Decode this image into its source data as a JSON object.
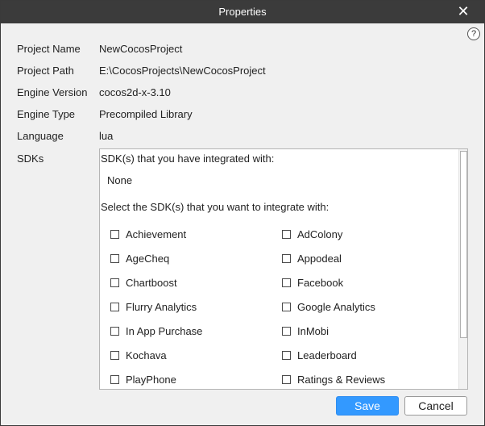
{
  "window": {
    "title": "Properties",
    "close_glyph": "✕",
    "help_glyph": "?"
  },
  "fields": [
    {
      "label": "Project Name",
      "value": "NewCocosProject"
    },
    {
      "label": "Project Path",
      "value": "E:\\CocosProjects\\NewCocosProject"
    },
    {
      "label": "Engine Version",
      "value": "cocos2d-x-3.10"
    },
    {
      "label": "Engine Type",
      "value": "Precompiled Library"
    },
    {
      "label": "Language",
      "value": "lua"
    }
  ],
  "sdks": {
    "label": "SDKs",
    "integrated_heading": "SDK(s) that you have integrated with:",
    "integrated_value": "None",
    "select_heading": "Select the SDK(s) that you want to integrate with:",
    "items": [
      {
        "label": "Achievement",
        "checked": false
      },
      {
        "label": "AdColony",
        "checked": false
      },
      {
        "label": "AgeCheq",
        "checked": false
      },
      {
        "label": "Appodeal",
        "checked": false
      },
      {
        "label": "Chartboost",
        "checked": false
      },
      {
        "label": "Facebook",
        "checked": false
      },
      {
        "label": "Flurry Analytics",
        "checked": false
      },
      {
        "label": "Google Analytics",
        "checked": false
      },
      {
        "label": "In App Purchase",
        "checked": false
      },
      {
        "label": "InMobi",
        "checked": false
      },
      {
        "label": "Kochava",
        "checked": false
      },
      {
        "label": "Leaderboard",
        "checked": false
      },
      {
        "label": "PlayPhone",
        "checked": false
      },
      {
        "label": "Ratings & Reviews",
        "checked": false
      }
    ]
  },
  "buttons": {
    "save": "Save",
    "cancel": "Cancel"
  },
  "colors": {
    "titlebar": "#3b3b3b",
    "accent": "#3399ff",
    "panel_bg": "#f0f0f0"
  }
}
